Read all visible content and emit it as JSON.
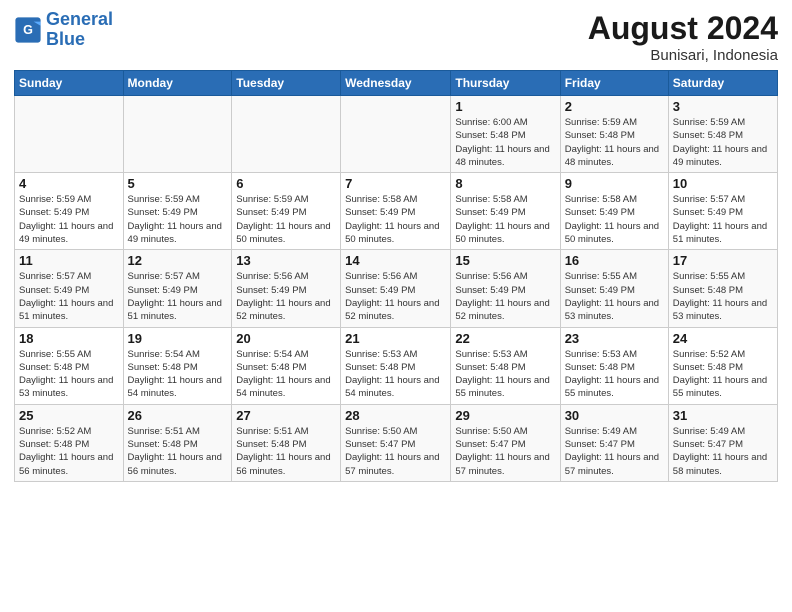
{
  "logo": {
    "text_general": "General",
    "text_blue": "Blue"
  },
  "header": {
    "title": "August 2024",
    "subtitle": "Bunisari, Indonesia"
  },
  "weekdays": [
    "Sunday",
    "Monday",
    "Tuesday",
    "Wednesday",
    "Thursday",
    "Friday",
    "Saturday"
  ],
  "weeks": [
    [
      {
        "day": "",
        "sunrise": "",
        "sunset": "",
        "daylight": ""
      },
      {
        "day": "",
        "sunrise": "",
        "sunset": "",
        "daylight": ""
      },
      {
        "day": "",
        "sunrise": "",
        "sunset": "",
        "daylight": ""
      },
      {
        "day": "",
        "sunrise": "",
        "sunset": "",
        "daylight": ""
      },
      {
        "day": "1",
        "sunrise": "Sunrise: 6:00 AM",
        "sunset": "Sunset: 5:48 PM",
        "daylight": "Daylight: 11 hours and 48 minutes."
      },
      {
        "day": "2",
        "sunrise": "Sunrise: 5:59 AM",
        "sunset": "Sunset: 5:48 PM",
        "daylight": "Daylight: 11 hours and 48 minutes."
      },
      {
        "day": "3",
        "sunrise": "Sunrise: 5:59 AM",
        "sunset": "Sunset: 5:48 PM",
        "daylight": "Daylight: 11 hours and 49 minutes."
      }
    ],
    [
      {
        "day": "4",
        "sunrise": "Sunrise: 5:59 AM",
        "sunset": "Sunset: 5:49 PM",
        "daylight": "Daylight: 11 hours and 49 minutes."
      },
      {
        "day": "5",
        "sunrise": "Sunrise: 5:59 AM",
        "sunset": "Sunset: 5:49 PM",
        "daylight": "Daylight: 11 hours and 49 minutes."
      },
      {
        "day": "6",
        "sunrise": "Sunrise: 5:59 AM",
        "sunset": "Sunset: 5:49 PM",
        "daylight": "Daylight: 11 hours and 50 minutes."
      },
      {
        "day": "7",
        "sunrise": "Sunrise: 5:58 AM",
        "sunset": "Sunset: 5:49 PM",
        "daylight": "Daylight: 11 hours and 50 minutes."
      },
      {
        "day": "8",
        "sunrise": "Sunrise: 5:58 AM",
        "sunset": "Sunset: 5:49 PM",
        "daylight": "Daylight: 11 hours and 50 minutes."
      },
      {
        "day": "9",
        "sunrise": "Sunrise: 5:58 AM",
        "sunset": "Sunset: 5:49 PM",
        "daylight": "Daylight: 11 hours and 50 minutes."
      },
      {
        "day": "10",
        "sunrise": "Sunrise: 5:57 AM",
        "sunset": "Sunset: 5:49 PM",
        "daylight": "Daylight: 11 hours and 51 minutes."
      }
    ],
    [
      {
        "day": "11",
        "sunrise": "Sunrise: 5:57 AM",
        "sunset": "Sunset: 5:49 PM",
        "daylight": "Daylight: 11 hours and 51 minutes."
      },
      {
        "day": "12",
        "sunrise": "Sunrise: 5:57 AM",
        "sunset": "Sunset: 5:49 PM",
        "daylight": "Daylight: 11 hours and 51 minutes."
      },
      {
        "day": "13",
        "sunrise": "Sunrise: 5:56 AM",
        "sunset": "Sunset: 5:49 PM",
        "daylight": "Daylight: 11 hours and 52 minutes."
      },
      {
        "day": "14",
        "sunrise": "Sunrise: 5:56 AM",
        "sunset": "Sunset: 5:49 PM",
        "daylight": "Daylight: 11 hours and 52 minutes."
      },
      {
        "day": "15",
        "sunrise": "Sunrise: 5:56 AM",
        "sunset": "Sunset: 5:49 PM",
        "daylight": "Daylight: 11 hours and 52 minutes."
      },
      {
        "day": "16",
        "sunrise": "Sunrise: 5:55 AM",
        "sunset": "Sunset: 5:49 PM",
        "daylight": "Daylight: 11 hours and 53 minutes."
      },
      {
        "day": "17",
        "sunrise": "Sunrise: 5:55 AM",
        "sunset": "Sunset: 5:48 PM",
        "daylight": "Daylight: 11 hours and 53 minutes."
      }
    ],
    [
      {
        "day": "18",
        "sunrise": "Sunrise: 5:55 AM",
        "sunset": "Sunset: 5:48 PM",
        "daylight": "Daylight: 11 hours and 53 minutes."
      },
      {
        "day": "19",
        "sunrise": "Sunrise: 5:54 AM",
        "sunset": "Sunset: 5:48 PM",
        "daylight": "Daylight: 11 hours and 54 minutes."
      },
      {
        "day": "20",
        "sunrise": "Sunrise: 5:54 AM",
        "sunset": "Sunset: 5:48 PM",
        "daylight": "Daylight: 11 hours and 54 minutes."
      },
      {
        "day": "21",
        "sunrise": "Sunrise: 5:53 AM",
        "sunset": "Sunset: 5:48 PM",
        "daylight": "Daylight: 11 hours and 54 minutes."
      },
      {
        "day": "22",
        "sunrise": "Sunrise: 5:53 AM",
        "sunset": "Sunset: 5:48 PM",
        "daylight": "Daylight: 11 hours and 55 minutes."
      },
      {
        "day": "23",
        "sunrise": "Sunrise: 5:53 AM",
        "sunset": "Sunset: 5:48 PM",
        "daylight": "Daylight: 11 hours and 55 minutes."
      },
      {
        "day": "24",
        "sunrise": "Sunrise: 5:52 AM",
        "sunset": "Sunset: 5:48 PM",
        "daylight": "Daylight: 11 hours and 55 minutes."
      }
    ],
    [
      {
        "day": "25",
        "sunrise": "Sunrise: 5:52 AM",
        "sunset": "Sunset: 5:48 PM",
        "daylight": "Daylight: 11 hours and 56 minutes."
      },
      {
        "day": "26",
        "sunrise": "Sunrise: 5:51 AM",
        "sunset": "Sunset: 5:48 PM",
        "daylight": "Daylight: 11 hours and 56 minutes."
      },
      {
        "day": "27",
        "sunrise": "Sunrise: 5:51 AM",
        "sunset": "Sunset: 5:48 PM",
        "daylight": "Daylight: 11 hours and 56 minutes."
      },
      {
        "day": "28",
        "sunrise": "Sunrise: 5:50 AM",
        "sunset": "Sunset: 5:47 PM",
        "daylight": "Daylight: 11 hours and 57 minutes."
      },
      {
        "day": "29",
        "sunrise": "Sunrise: 5:50 AM",
        "sunset": "Sunset: 5:47 PM",
        "daylight": "Daylight: 11 hours and 57 minutes."
      },
      {
        "day": "30",
        "sunrise": "Sunrise: 5:49 AM",
        "sunset": "Sunset: 5:47 PM",
        "daylight": "Daylight: 11 hours and 57 minutes."
      },
      {
        "day": "31",
        "sunrise": "Sunrise: 5:49 AM",
        "sunset": "Sunset: 5:47 PM",
        "daylight": "Daylight: 11 hours and 58 minutes."
      }
    ]
  ]
}
